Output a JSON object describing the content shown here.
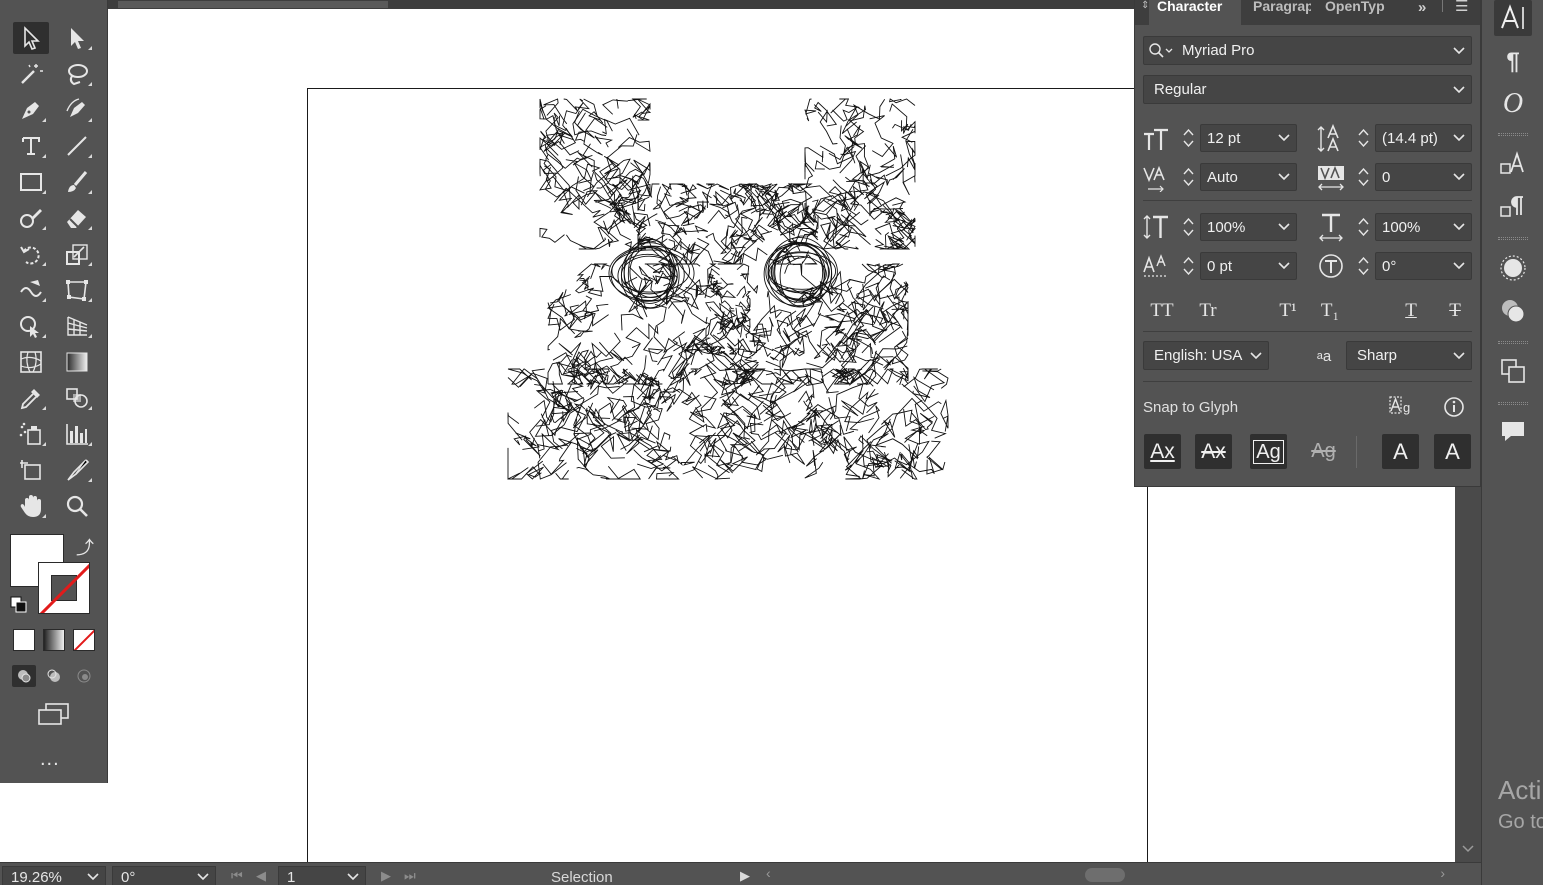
{
  "document": {
    "artwork": "owl-line-drawing"
  },
  "toolbar": {
    "tools": [
      {
        "name": "selection-tool",
        "icon": "arrow-icon",
        "active": true
      },
      {
        "name": "direct-selection-tool",
        "icon": "white-arrow-icon"
      },
      {
        "name": "magic-wand-tool",
        "icon": "magic-wand-icon"
      },
      {
        "name": "lasso-tool",
        "icon": "lasso-icon"
      },
      {
        "name": "pen-tool",
        "icon": "pen-icon"
      },
      {
        "name": "curvature-tool",
        "icon": "curvature-icon"
      },
      {
        "name": "type-tool",
        "icon": "type-icon"
      },
      {
        "name": "line-segment-tool",
        "icon": "line-icon"
      },
      {
        "name": "rectangle-tool",
        "icon": "rectangle-icon"
      },
      {
        "name": "paintbrush-tool",
        "icon": "brush-icon"
      },
      {
        "name": "shaper-tool",
        "icon": "shaper-icon"
      },
      {
        "name": "eraser-tool",
        "icon": "eraser-icon"
      },
      {
        "name": "rotate-tool",
        "icon": "rotate-icon"
      },
      {
        "name": "scale-tool",
        "icon": "scale-icon"
      },
      {
        "name": "warp-tool",
        "icon": "warp-icon"
      },
      {
        "name": "free-transform-tool",
        "icon": "free-transform-icon"
      },
      {
        "name": "shape-builder-tool",
        "icon": "shape-builder-icon"
      },
      {
        "name": "perspective-grid-tool",
        "icon": "perspective-icon"
      },
      {
        "name": "mesh-tool",
        "icon": "mesh-icon"
      },
      {
        "name": "gradient-tool",
        "icon": "gradient-icon"
      },
      {
        "name": "eyedropper-tool",
        "icon": "eyedropper-icon"
      },
      {
        "name": "blend-tool",
        "icon": "blend-icon"
      },
      {
        "name": "symbol-sprayer-tool",
        "icon": "symbol-sprayer-icon"
      },
      {
        "name": "column-graph-tool",
        "icon": "graph-icon"
      },
      {
        "name": "artboard-tool",
        "icon": "artboard-icon"
      },
      {
        "name": "slice-tool",
        "icon": "slice-icon"
      },
      {
        "name": "hand-tool",
        "icon": "hand-icon"
      },
      {
        "name": "zoom-tool",
        "icon": "zoom-icon"
      }
    ],
    "more": "..."
  },
  "character_panel": {
    "tabs": [
      "Character",
      "Paragraph",
      "OpenType"
    ],
    "active_tab": "Character",
    "font_family": "Myriad Pro",
    "font_style": "Regular",
    "font_size": "12 pt",
    "leading": "(14.4 pt)",
    "kerning": "Auto",
    "tracking": "0",
    "vertical_scale": "100%",
    "horizontal_scale": "100%",
    "baseline_shift": "0 pt",
    "character_rotation": "0°",
    "language": "English: USA",
    "anti_aliasing": "Sharp",
    "snap_to_glyph_label": "Snap to Glyph",
    "typo_buttons": {
      "all_caps": "TT",
      "small_caps": "Tr",
      "superscript": "T¹",
      "subscript": "T₁",
      "underline": "T",
      "strikethrough": "T"
    },
    "glyph_buttons": {
      "baseline": "Ax",
      "x_height": "Ax",
      "glyph_bounds": "Ag",
      "proximity": "Ag",
      "angular": "A",
      "anchor": "A"
    }
  },
  "status_bar": {
    "zoom": "19.26%",
    "rotation": "0°",
    "artboard_number": "1",
    "mode": "Selection"
  },
  "watermark": {
    "line1": "Acti",
    "line2": "Go to"
  },
  "colors": {
    "ui_bg": "#535353",
    "ui_dark": "#3e3e3e",
    "field": "#454545",
    "none_red": "#e21b1b"
  }
}
